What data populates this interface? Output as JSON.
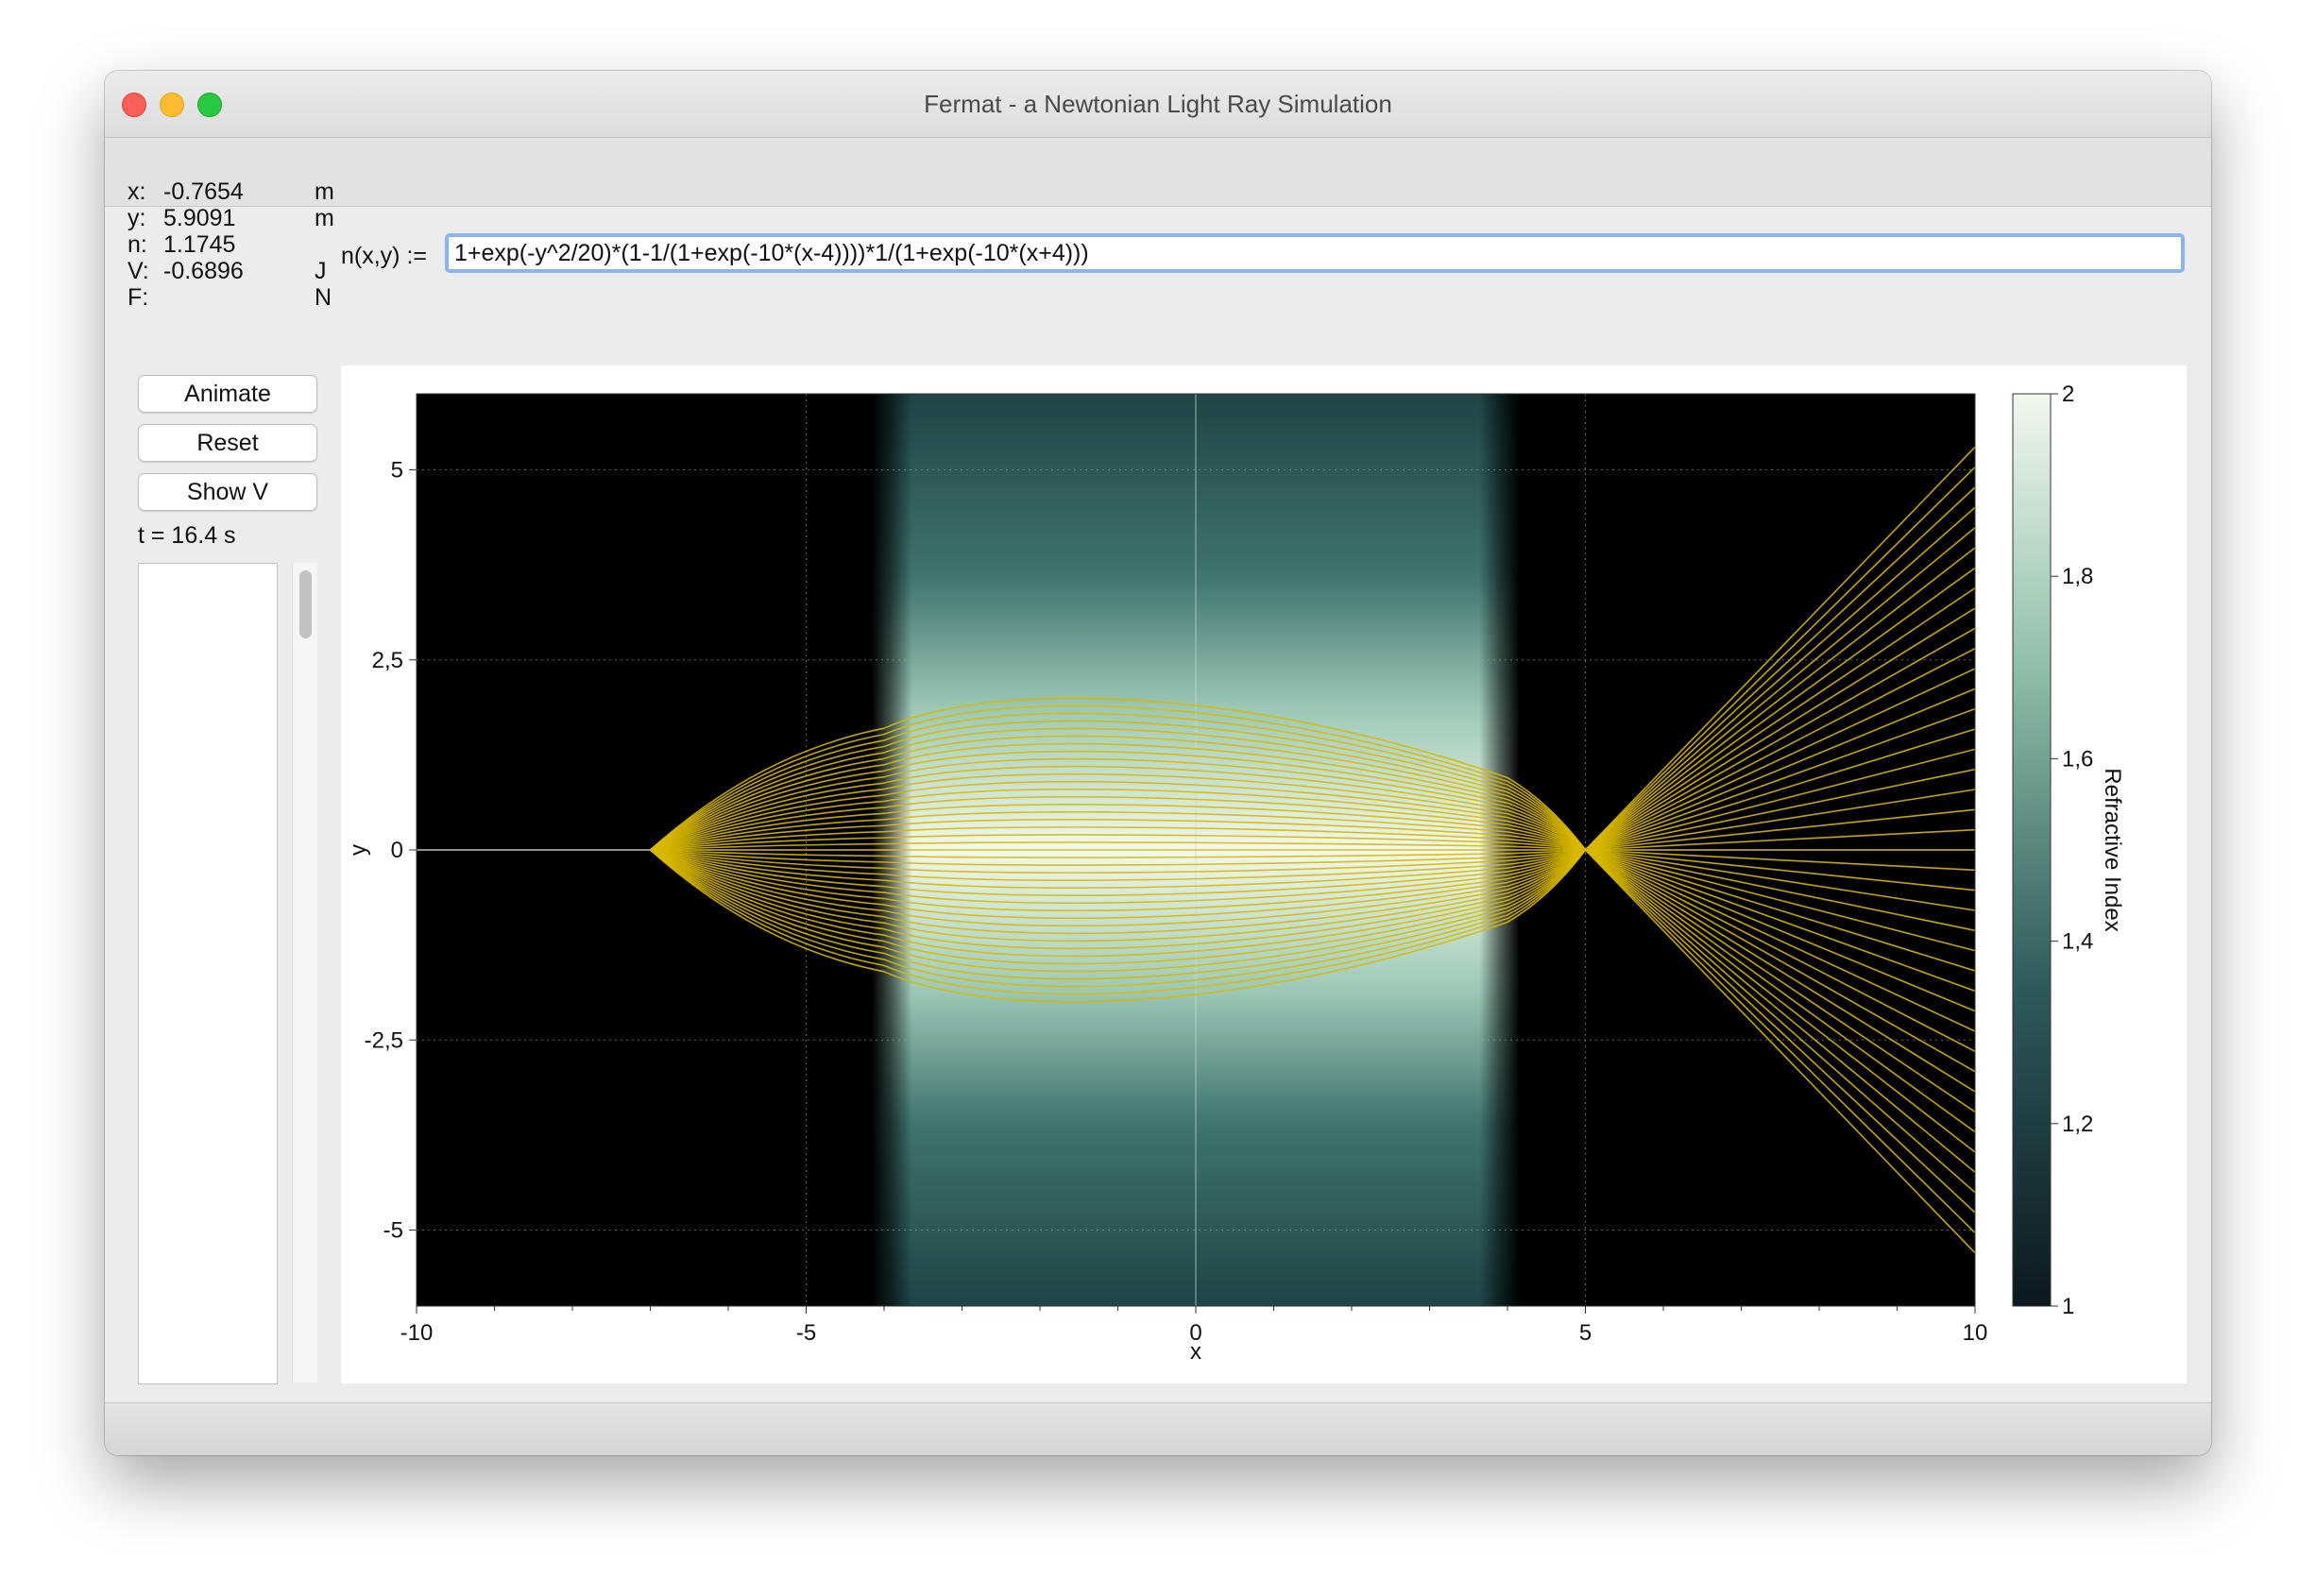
{
  "window": {
    "title": "Fermat - a Newtonian Light Ray Simulation"
  },
  "readouts": [
    {
      "label": "x:",
      "value": "-0.7654",
      "unit": "m"
    },
    {
      "label": "y:",
      "value": "5.9091",
      "unit": "m"
    },
    {
      "label": "n:",
      "value": "1.1745",
      "unit": ""
    },
    {
      "label": "V:",
      "value": "-0.6896",
      "unit": "J"
    },
    {
      "label": "F:",
      "value": "",
      "unit": "N"
    }
  ],
  "formula": {
    "label": "n(x,y) :=",
    "value": "1+exp(-y^2/20)*(1-1/(1+exp(-10*(x-4))))*1/(1+exp(-10*(x+4)))"
  },
  "buttons": {
    "animate": "Animate",
    "reset": "Reset",
    "show_v": "Show V"
  },
  "time_label": "t = 16.4 s",
  "colors": {
    "background_low": "#0c1820",
    "background_high": "#f2f8ec",
    "rays": "#d8b800"
  },
  "chart_data": {
    "type": "heatmap",
    "xlabel": "x",
    "ylabel": "y",
    "xlim": [
      -10,
      10
    ],
    "ylim": [
      -6,
      6
    ],
    "x_ticks": [
      "-10",
      "-5",
      "0",
      "5",
      "10"
    ],
    "y_ticks": [
      "5",
      "2,5",
      "0",
      "-2,5",
      "-5"
    ],
    "colorbar": {
      "label": "Refractive Index",
      "range": [
        1,
        2
      ],
      "ticks": [
        "2",
        "1,8",
        "1,6",
        "1,4",
        "1,2",
        "1"
      ]
    },
    "rays": {
      "count": 41,
      "source": [
        -7,
        0
      ],
      "initial_angle_max_deg": 38,
      "lens_entry_x": -4,
      "lens_exit_x": 4,
      "max_height_in_lens": 2.0,
      "focus": [
        5,
        0
      ],
      "exit_y_at_x10_range": [
        -5.3,
        5.3
      ]
    },
    "grid": true
  }
}
